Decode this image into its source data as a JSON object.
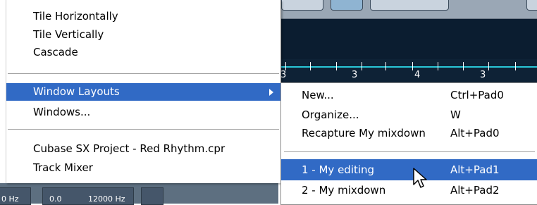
{
  "ruler": {
    "marks": [
      "3",
      "3",
      "4",
      "3"
    ]
  },
  "bottom_panel": {
    "texts": [
      "0 Hz",
      "0.0",
      "12000 Hz"
    ]
  },
  "menu": {
    "items": [
      {
        "label": "Tile Horizontally"
      },
      {
        "label": "Tile Vertically"
      },
      {
        "label": "Cascade"
      },
      {
        "label": "Window Layouts",
        "selected": true,
        "has_submenu": true
      },
      {
        "label": "Windows..."
      },
      {
        "label": "Cubase SX Project - Red Rhythm.cpr"
      },
      {
        "label": "Track Mixer"
      }
    ]
  },
  "submenu": {
    "items": [
      {
        "label": "New...",
        "shortcut": "Ctrl+Pad0"
      },
      {
        "label": "Organize...",
        "shortcut": "W"
      },
      {
        "label": "Recapture My mixdown",
        "shortcut": "Alt+Pad0"
      },
      {
        "label": "1 - My editing",
        "shortcut": "Alt+Pad1",
        "selected": true
      },
      {
        "label": "2 - My mixdown",
        "shortcut": "Alt+Pad2"
      }
    ]
  },
  "colors": {
    "selection": "#316ac5",
    "ruler_line": "#29c7d8",
    "dark_bg": "#0b1d30"
  },
  "icons": {
    "submenu_arrow": "triangle-right",
    "pointer": "arrow-cursor"
  }
}
